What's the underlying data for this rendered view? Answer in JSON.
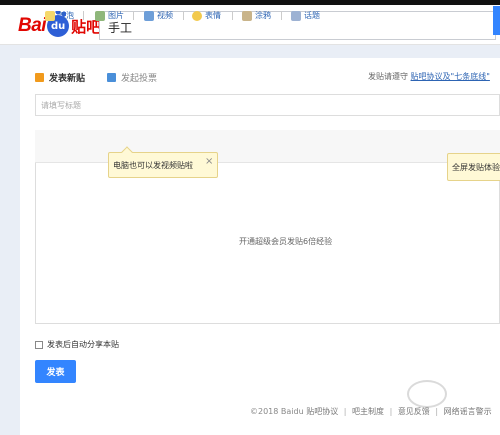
{
  "header": {
    "logo_bai": "Bai",
    "logo_du": "du",
    "logo_tieba": "贴吧",
    "search_value": "手工"
  },
  "post": {
    "tab_new": "发表新贴",
    "tab_vote": "发起投票",
    "notice_prefix": "发贴请遵守",
    "notice_link": "贴吧协议及\"七条底线\"",
    "title_placeholder": "请填写标题",
    "toolbar": [
      "气泡",
      "图片",
      "视频",
      "表情",
      "涂鸦",
      "话题"
    ],
    "tip_video": "电脑也可以发视频贴啦",
    "tip_close": "×",
    "tip_fullscreen": "全屏发贴体验",
    "editor_placeholder": "开通超级会员发贴6倍经验",
    "share_label": "发表后自动分享本贴",
    "submit_label": "发表"
  },
  "footer": {
    "copyright": "©2018 Baidu",
    "links": [
      "贴吧协议",
      "吧主制度",
      "意见反馈",
      "网络谣言警示"
    ]
  },
  "colors": {
    "brand_red": "#e10601",
    "brand_blue": "#3385ff",
    "link_blue": "#2d64b3"
  }
}
